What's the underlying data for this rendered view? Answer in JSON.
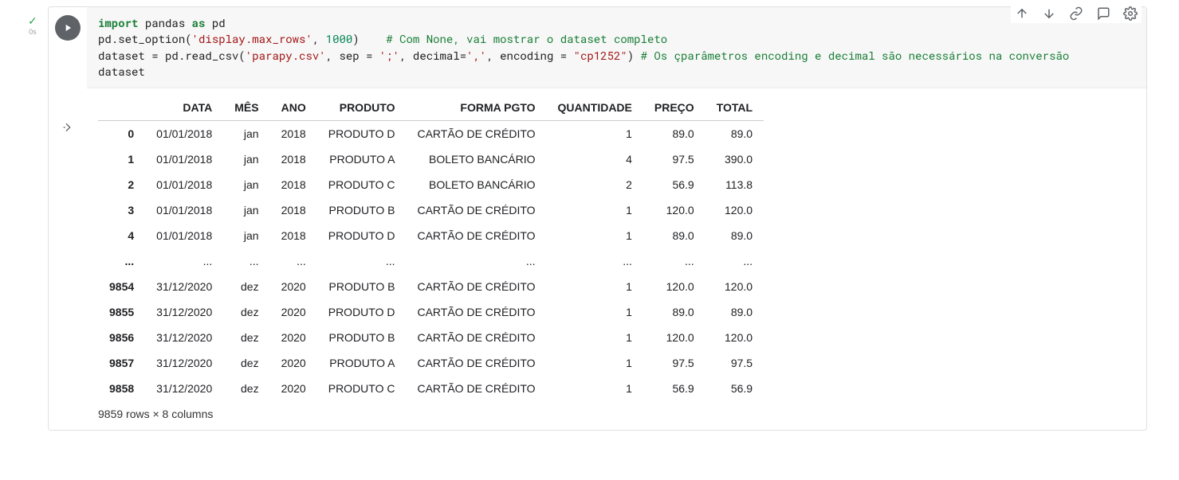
{
  "status": {
    "check": "✓",
    "time": "0s"
  },
  "toolbar": {
    "move_up": "↑",
    "move_down": "↓",
    "link": "link",
    "comment": "comment",
    "settings": "settings"
  },
  "code": {
    "l1_import": "import",
    "l1_pandas": " pandas ",
    "l1_as": "as",
    "l1_pd": " pd",
    "l2_a": "pd.set_option(",
    "l2_str": "'display.max_rows'",
    "l2_b": ", ",
    "l2_num": "1000",
    "l2_c": ")    ",
    "l2_cm": "# Com None, vai mostrar o dataset completo",
    "l3_a": "dataset = pd.read_csv(",
    "l3_s1": "'parapy.csv'",
    "l3_b": ", sep = ",
    "l3_s2": "';'",
    "l3_c": ", decimal=",
    "l3_s3": "','",
    "l3_d": ", encoding = ",
    "l3_s4": "\"cp1252\"",
    "l3_e": ") ",
    "l3_cm": "# Os çparâmetros encoding e decimal são necessários na conversão",
    "l4": "dataset"
  },
  "table": {
    "headers": [
      "",
      "DATA",
      "MÊS",
      "ANO",
      "PRODUTO",
      "FORMA PGTO",
      "QUANTIDADE",
      "PREÇO",
      "TOTAL"
    ],
    "rows": [
      {
        "idx": "0",
        "data": "01/01/2018",
        "mes": "jan",
        "ano": "2018",
        "produto": "PRODUTO D",
        "forma": "CARTÃO DE CRÉDITO",
        "qtd": "1",
        "preco": "89.0",
        "total": "89.0"
      },
      {
        "idx": "1",
        "data": "01/01/2018",
        "mes": "jan",
        "ano": "2018",
        "produto": "PRODUTO A",
        "forma": "BOLETO BANCÁRIO",
        "qtd": "4",
        "preco": "97.5",
        "total": "390.0"
      },
      {
        "idx": "2",
        "data": "01/01/2018",
        "mes": "jan",
        "ano": "2018",
        "produto": "PRODUTO C",
        "forma": "BOLETO BANCÁRIO",
        "qtd": "2",
        "preco": "56.9",
        "total": "113.8"
      },
      {
        "idx": "3",
        "data": "01/01/2018",
        "mes": "jan",
        "ano": "2018",
        "produto": "PRODUTO B",
        "forma": "CARTÃO DE CRÉDITO",
        "qtd": "1",
        "preco": "120.0",
        "total": "120.0"
      },
      {
        "idx": "4",
        "data": "01/01/2018",
        "mes": "jan",
        "ano": "2018",
        "produto": "PRODUTO D",
        "forma": "CARTÃO DE CRÉDITO",
        "qtd": "1",
        "preco": "89.0",
        "total": "89.0"
      }
    ],
    "ellipsis": "...",
    "rows_after": [
      {
        "idx": "9854",
        "data": "31/12/2020",
        "mes": "dez",
        "ano": "2020",
        "produto": "PRODUTO B",
        "forma": "CARTÃO DE CRÉDITO",
        "qtd": "1",
        "preco": "120.0",
        "total": "120.0"
      },
      {
        "idx": "9855",
        "data": "31/12/2020",
        "mes": "dez",
        "ano": "2020",
        "produto": "PRODUTO D",
        "forma": "CARTÃO DE CRÉDITO",
        "qtd": "1",
        "preco": "89.0",
        "total": "89.0"
      },
      {
        "idx": "9856",
        "data": "31/12/2020",
        "mes": "dez",
        "ano": "2020",
        "produto": "PRODUTO B",
        "forma": "CARTÃO DE CRÉDITO",
        "qtd": "1",
        "preco": "120.0",
        "total": "120.0"
      },
      {
        "idx": "9857",
        "data": "31/12/2020",
        "mes": "dez",
        "ano": "2020",
        "produto": "PRODUTO A",
        "forma": "CARTÃO DE CRÉDITO",
        "qtd": "1",
        "preco": "97.5",
        "total": "97.5"
      },
      {
        "idx": "9858",
        "data": "31/12/2020",
        "mes": "dez",
        "ano": "2020",
        "produto": "PRODUTO C",
        "forma": "CARTÃO DE CRÉDITO",
        "qtd": "1",
        "preco": "56.9",
        "total": "56.9"
      }
    ],
    "summary": "9859 rows × 8 columns"
  }
}
